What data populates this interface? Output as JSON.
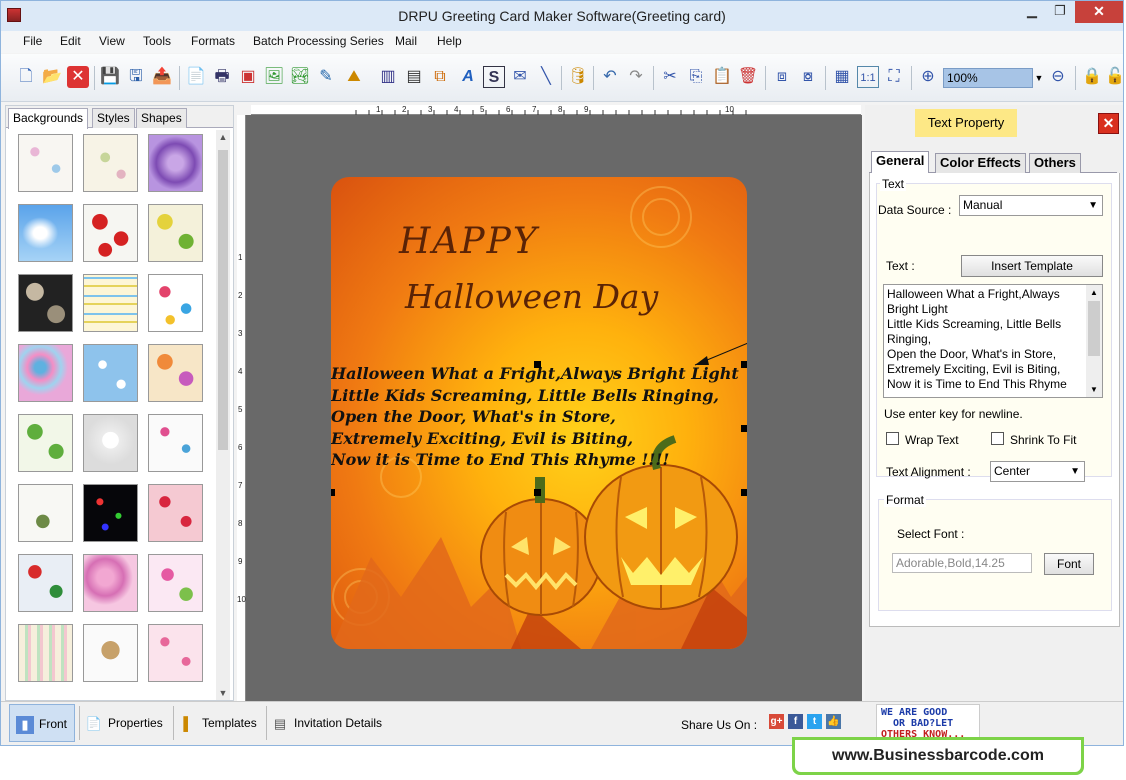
{
  "window": {
    "title": "DRPU Greeting Card Maker Software(Greeting card)",
    "min": "▁",
    "max": "❐",
    "close": "✕"
  },
  "menu": [
    "File",
    "Edit",
    "View",
    "Tools",
    "Formats",
    "Batch Processing Series",
    "Mail",
    "Help"
  ],
  "toolbar": {
    "zoom": "100%"
  },
  "left_tabs": [
    "Backgrounds",
    "Styles",
    "Shapes"
  ],
  "card": {
    "title1": "HAPPY",
    "title2": "Halloween Day",
    "verse": [
      "Halloween What a Fright,Always Bright Light",
      "Little Kids Screaming, Little Bells Ringing,",
      "Open the Door, What's in Store,",
      "Extremely Exciting, Evil is Biting,",
      "Now it is Time to End This Rhyme !!!!"
    ]
  },
  "ruler": {
    "h": [
      "1",
      "2",
      "3",
      "4",
      "5",
      "6",
      "7",
      "8",
      "9",
      "10"
    ],
    "v": [
      "1",
      "2",
      "3",
      "4",
      "5",
      "6",
      "7",
      "8",
      "9",
      "10"
    ]
  },
  "text_property": {
    "label": "Text Property",
    "close": "✕",
    "tabs": [
      "General",
      "Color Effects",
      "Others"
    ],
    "text_group": "Text",
    "data_source_label": "Data Source :",
    "data_source_value": "Manual",
    "text_label": "Text :",
    "insert_template": "Insert Template",
    "text_lines": [
      "Halloween What a Fright,Always",
      "Bright Light",
      "Little Kids Screaming, Little Bells",
      "Ringing,",
      "Open the Door, What's in Store,",
      "Extremely Exciting, Evil is Biting,",
      "Now it is Time to End This Rhyme"
    ],
    "hint": "Use enter key for newline.",
    "wrap_text": "Wrap Text",
    "shrink_to_fit": "Shrink To Fit",
    "alignment_label": "Text Alignment :",
    "alignment_value": "Center",
    "format_group": "Format",
    "select_font_label": "Select Font :",
    "font_value": "Adorable,Bold,14.25",
    "font_button": "Font"
  },
  "bottom": {
    "front": "Front",
    "properties": "Properties",
    "templates": "Templates",
    "invitation": "Invitation Details",
    "share": "Share Us On :"
  },
  "ad": {
    "line1": "WE ARE GOOD",
    "line2": "OR BAD?LET",
    "line3": "OTHERS KNOW..."
  },
  "banner": "www.Businessbarcode.com",
  "colors": {
    "title_bg": "#dce9f7",
    "accent_close": "#c7413b",
    "tp_label": "#fde886",
    "card_text": "#5a2306"
  }
}
